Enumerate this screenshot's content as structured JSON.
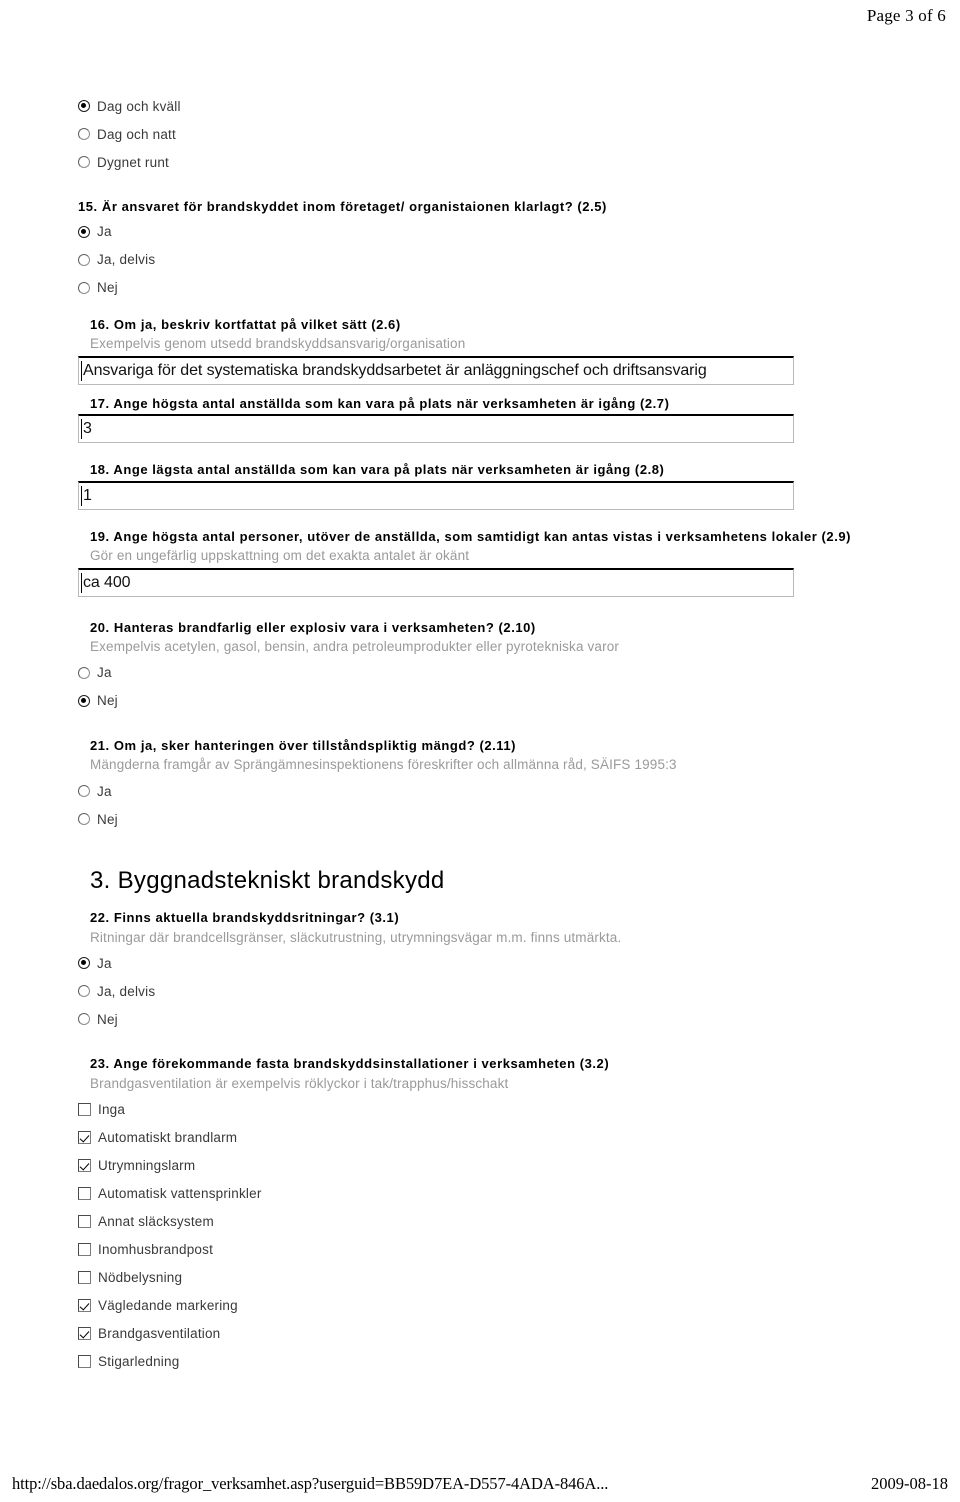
{
  "page": {
    "header_label": "Page 3 of 6",
    "footer_url": "http://sba.daedalos.org/fragor_verksamhet.asp?userguid=BB59D7EA-D557-4ADA-846A...",
    "footer_date": "2009-08-18"
  },
  "top_options": {
    "items": [
      {
        "label": "Dag och kväll",
        "selected": true
      },
      {
        "label": "Dag och natt",
        "selected": false
      },
      {
        "label": "Dygnet runt",
        "selected": false
      }
    ]
  },
  "q15": {
    "title": "15. Är ansvaret för brandskyddet inom företaget/ organistaionen klarlagt? (2.5)",
    "options": [
      {
        "label": "Ja",
        "selected": true
      },
      {
        "label": "Ja, delvis",
        "selected": false
      },
      {
        "label": "Nej",
        "selected": false
      }
    ]
  },
  "q16": {
    "title": "16. Om ja, beskriv kortfattat på vilket sätt (2.6)",
    "hint": "Exempelvis genom utsedd brandskyddsansvarig/organisation",
    "value": "Ansvariga för det systematiska brandskyddsarbetet är anläggningschef och driftsansvarig"
  },
  "q17": {
    "title": "17. Ange högsta antal anställda som kan vara på plats när verksamheten är igång (2.7)",
    "value": "3"
  },
  "q18": {
    "title": "18. Ange lägsta antal anställda som kan vara på plats när verksamheten är igång (2.8)",
    "value": "1"
  },
  "q19": {
    "title": "19. Ange högsta antal personer, utöver de anställda, som samtidigt kan antas vistas i verksamhetens lokaler (2.9)",
    "hint": "Gör en ungefärlig uppskattning om det exakta antalet är okänt",
    "value": "ca 400"
  },
  "q20": {
    "title": "20. Hanteras brandfarlig eller explosiv vara i verksamheten? (2.10)",
    "hint": "Exempelvis acetylen, gasol, bensin, andra petroleumprodukter eller pyrotekniska varor",
    "options": [
      {
        "label": "Ja",
        "selected": false
      },
      {
        "label": "Nej",
        "selected": true
      }
    ]
  },
  "q21": {
    "title": "21. Om ja, sker hanteringen över tillståndspliktig mängd? (2.11)",
    "hint": "Mängderna framgår av Sprängämnesinspektionens föreskrifter och allmänna råd, SÄIFS 1995:3",
    "options": [
      {
        "label": "Ja",
        "selected": false
      },
      {
        "label": "Nej",
        "selected": false
      }
    ]
  },
  "section3": {
    "heading": "3. Byggnadstekniskt brandskydd"
  },
  "q22": {
    "title": "22. Finns aktuella brandskyddsritningar? (3.1)",
    "hint": "Ritningar där brandcellsgränser, släckutrustning, utrymningsvägar m.m. finns utmärkta.",
    "options": [
      {
        "label": "Ja",
        "selected": true
      },
      {
        "label": "Ja, delvis",
        "selected": false
      },
      {
        "label": "Nej",
        "selected": false
      }
    ]
  },
  "q23": {
    "title": "23. Ange förekommande fasta brandskyddsinstallationer i verksamheten (3.2)",
    "hint": "Brandgasventilation är exempelvis röklyckor i tak/trapphus/hisschakt",
    "options": [
      {
        "label": "Inga",
        "checked": false
      },
      {
        "label": "Automatiskt brandlarm",
        "checked": true
      },
      {
        "label": "Utrymningslarm",
        "checked": true
      },
      {
        "label": "Automatisk vattensprinkler",
        "checked": false
      },
      {
        "label": "Annat släcksystem",
        "checked": false
      },
      {
        "label": "Inomhusbrandpost",
        "checked": false
      },
      {
        "label": "Nödbelysning",
        "checked": false
      },
      {
        "label": "Vägledande markering",
        "checked": true
      },
      {
        "label": "Brandgasventilation",
        "checked": true
      },
      {
        "label": "Stigarledning",
        "checked": false
      }
    ]
  }
}
